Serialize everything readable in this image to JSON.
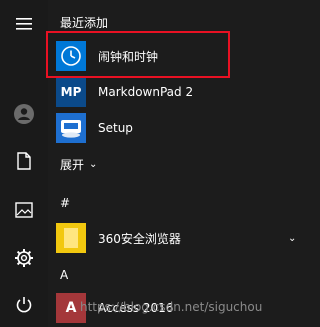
{
  "rail": {
    "items": [
      {
        "name": "hamburger-icon"
      },
      {
        "name": "user-avatar-icon"
      },
      {
        "name": "documents-icon"
      },
      {
        "name": "pictures-icon"
      },
      {
        "name": "settings-icon"
      },
      {
        "name": "power-icon"
      }
    ]
  },
  "recent": {
    "header": "最近添加",
    "items": [
      {
        "label": "闹钟和时钟",
        "icon": "clock-icon",
        "tile_color": "#0078d7"
      },
      {
        "label": "MarkdownPad 2",
        "icon": "markdownpad-icon",
        "tile_color": "#0b4a8a"
      },
      {
        "label": "Setup",
        "icon": "setup-icon",
        "tile_color": "#1e6fd0"
      }
    ]
  },
  "expand": {
    "label": "展开"
  },
  "groups": [
    {
      "header": "#",
      "items": [
        {
          "label": "360安全浏览器",
          "icon": "folder-icon",
          "tile_color": "#f2c80f"
        }
      ]
    },
    {
      "header": "A",
      "items": [
        {
          "label": "Access 2016",
          "icon": "access-icon",
          "tile_color": "#a4373a"
        }
      ]
    }
  ],
  "watermark": "https://blog.csdn.net/siguchou",
  "colors": {
    "background": "#1c1c1c",
    "highlight_border": "#e81123"
  }
}
